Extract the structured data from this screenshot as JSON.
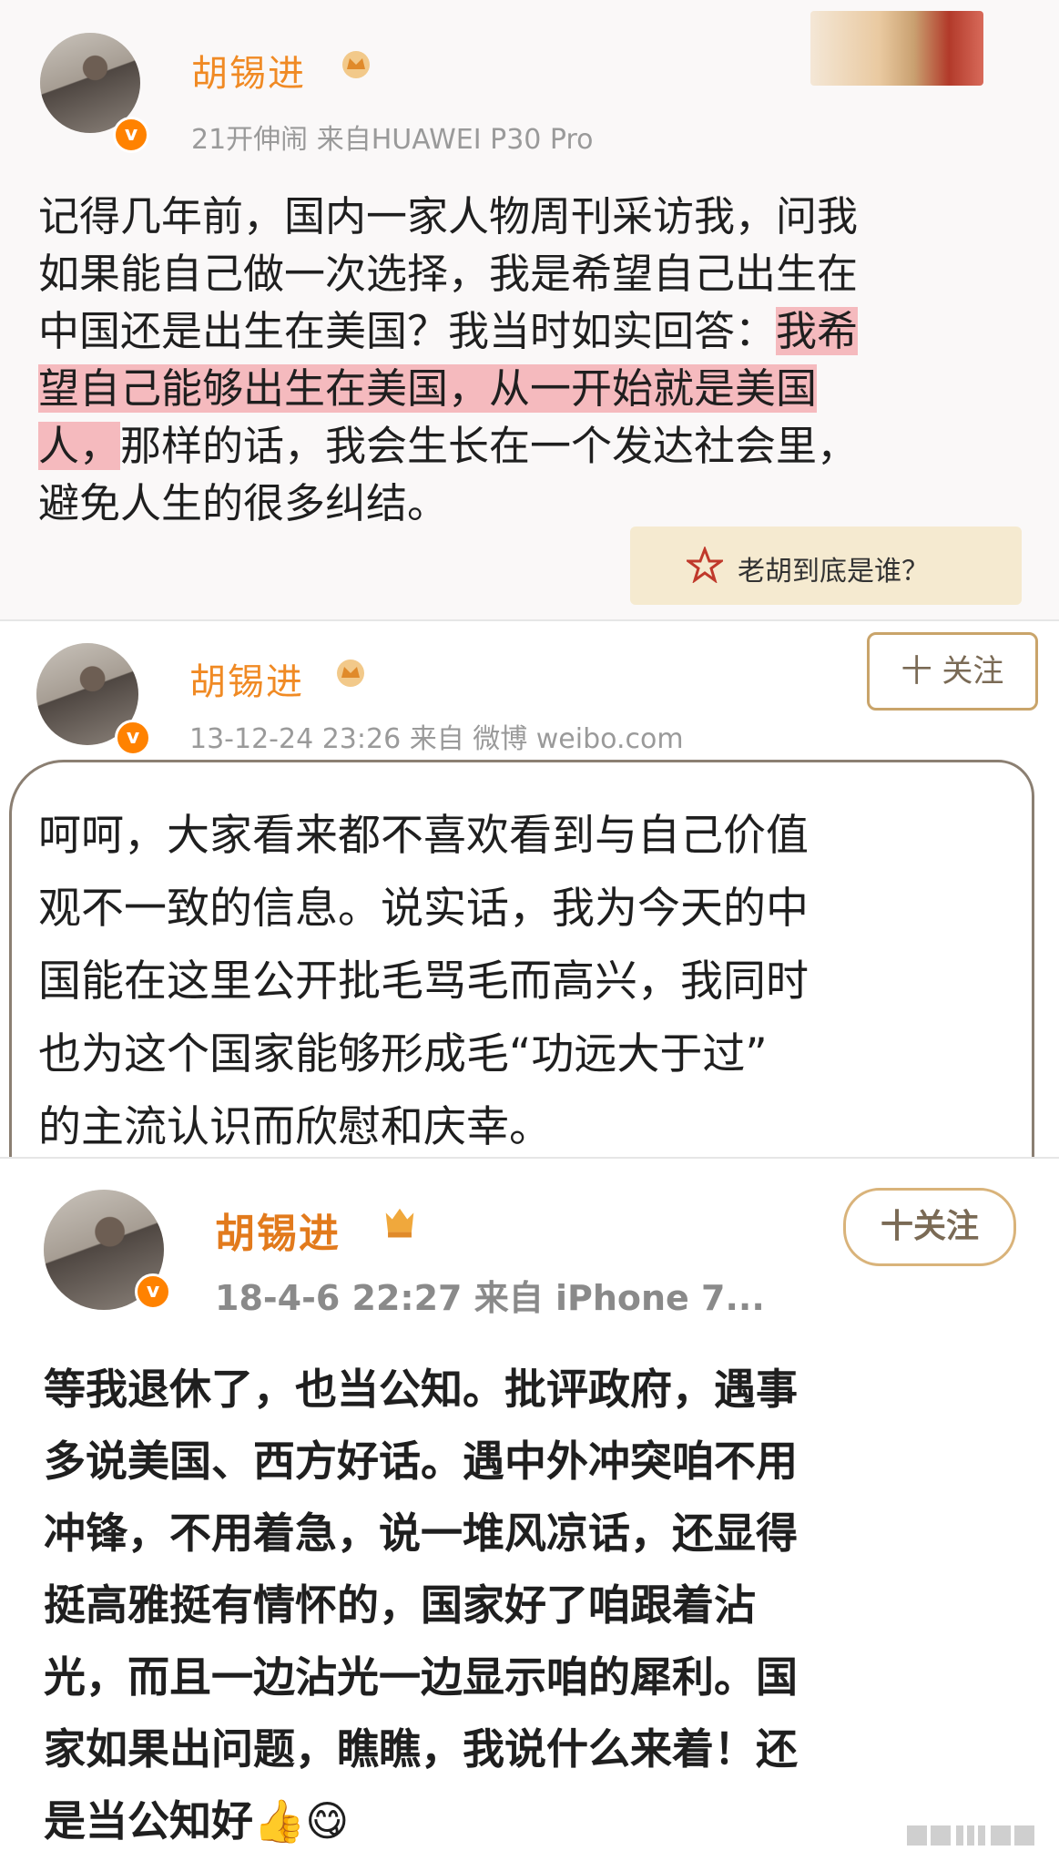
{
  "posts": [
    {
      "name": "胡锡进",
      "meta": "21开伸闹 来自HUAWEI P30 Pro",
      "lines": [
        "记得几年前，国内一家人物周刊采访我，问我",
        "如果能自己做一次选择，我是希望自己出生在",
        "中国还是出生在美国？我当时如实回答：",
        "我希",
        "望自己能够出生在美国，",
        "从一开始就是美国",
        "人，",
        "那样的话，我会生长在一个发达社会里，",
        "避免人生的很多纠结。"
      ],
      "sticker": "老胡到底是谁？"
    },
    {
      "name": "胡锡进",
      "meta": "13-12-24 23:26  来自 微博 weibo.com",
      "follow": "十 关注",
      "lines": [
        "呵呵，大家看来都不喜欢看到与自己价值",
        "观不一致的信息。说实话，我为今天的中",
        "国能在这里公开批毛骂毛而高兴，我同时",
        "也为这个国家能够形成毛“功远大于过”",
        "的主流认识而欣慰和庆幸。"
      ]
    },
    {
      "name": "胡锡进",
      "meta": "18-4-6 22:27  来自 iPhone 7...",
      "follow": "十关注",
      "lines": [
        "等我退休了，也当公知。批评政府，遇事",
        "多说美国、西方好话。遇中外冲突咱不用",
        "冲锋，不用着急，说一堆风凉话，还显得",
        "挺高雅挺有情怀的，国家好了咱跟着沾",
        "光，而且一边沾光一边显示咱的犀利。国",
        "家如果出问题，瞧瞧，我说什么来着！还",
        "是当公知好"
      ],
      "emoji": [
        "👍",
        "😋"
      ]
    }
  ],
  "vbadge": "v",
  "colors": {
    "name": "#f08a24",
    "badge": "#ff8200",
    "highlight": "#f06e78"
  }
}
